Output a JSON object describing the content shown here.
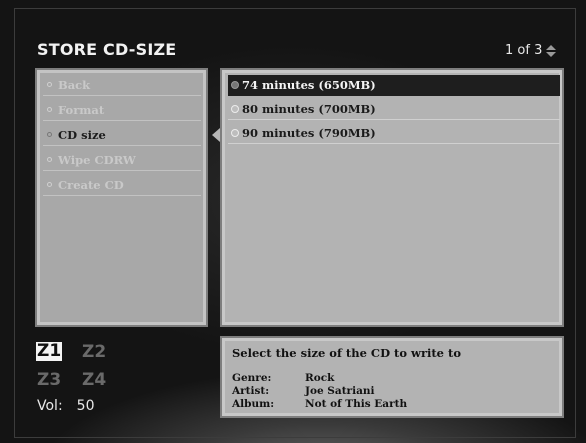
{
  "header": {
    "title": "STORE CD-SIZE",
    "pager": "1 of 3"
  },
  "menu": {
    "items": [
      {
        "label": "Back",
        "active": false
      },
      {
        "label": "Format",
        "active": false
      },
      {
        "label": "CD size",
        "active": true
      },
      {
        "label": "Wipe CDRW",
        "active": false
      },
      {
        "label": "Create CD",
        "active": false
      }
    ]
  },
  "options": {
    "items": [
      {
        "label": "74 minutes (650MB)",
        "selected": true
      },
      {
        "label": "80 minutes (700MB)",
        "selected": false
      },
      {
        "label": "90 minutes (790MB)",
        "selected": false
      }
    ]
  },
  "info": {
    "description": "Select the size of the CD to write to",
    "genre_label": "Genre:",
    "genre_value": "Rock",
    "artist_label": "Artist:",
    "artist_value": "Joe Satriani",
    "album_label": "Album:",
    "album_value": "Not of This Earth"
  },
  "zones": {
    "z1": "Z1",
    "z2": "Z2",
    "z3": "Z3",
    "z4": "Z4",
    "active": "Z1"
  },
  "volume": {
    "label": "Vol:",
    "value": "50"
  },
  "icons": {
    "pager": "up-down-arrows-icon"
  }
}
